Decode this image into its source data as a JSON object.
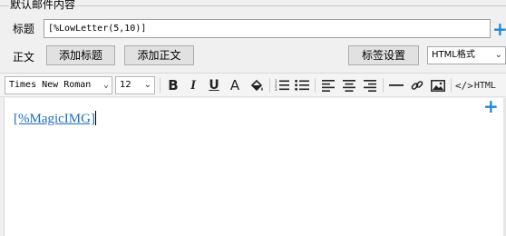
{
  "group": {
    "title": "默认邮件内容"
  },
  "title_row": {
    "label": "标题",
    "value": "[%LowLetter(5,10)]",
    "add_icon": "plus-icon"
  },
  "body_row": {
    "label": "正文",
    "add_title_button": "添加标题",
    "add_body_button": "添加正文",
    "tag_settings_button": "标签设置",
    "format_select": "HTML格式"
  },
  "toolbar": {
    "font_family": "Times New Roman",
    "font_size": "12",
    "bold_label": "B",
    "italic_label": "I",
    "underline_label": "U",
    "font_color_label": "A",
    "source_label": "HTML",
    "icons": [
      "bold-icon",
      "italic-icon",
      "underline-icon",
      "font-color-icon",
      "paint-bucket-icon",
      "ordered-list-icon",
      "unordered-list-icon",
      "align-left-icon",
      "align-center-icon",
      "align-right-icon",
      "horizontal-rule-icon",
      "link-icon",
      "image-icon",
      "code-icon"
    ]
  },
  "editor": {
    "content": "[%MagicIMG]",
    "add_icon": "plus-icon"
  },
  "colors": {
    "accent": "#1e88d6",
    "link": "#1f6cc0"
  }
}
